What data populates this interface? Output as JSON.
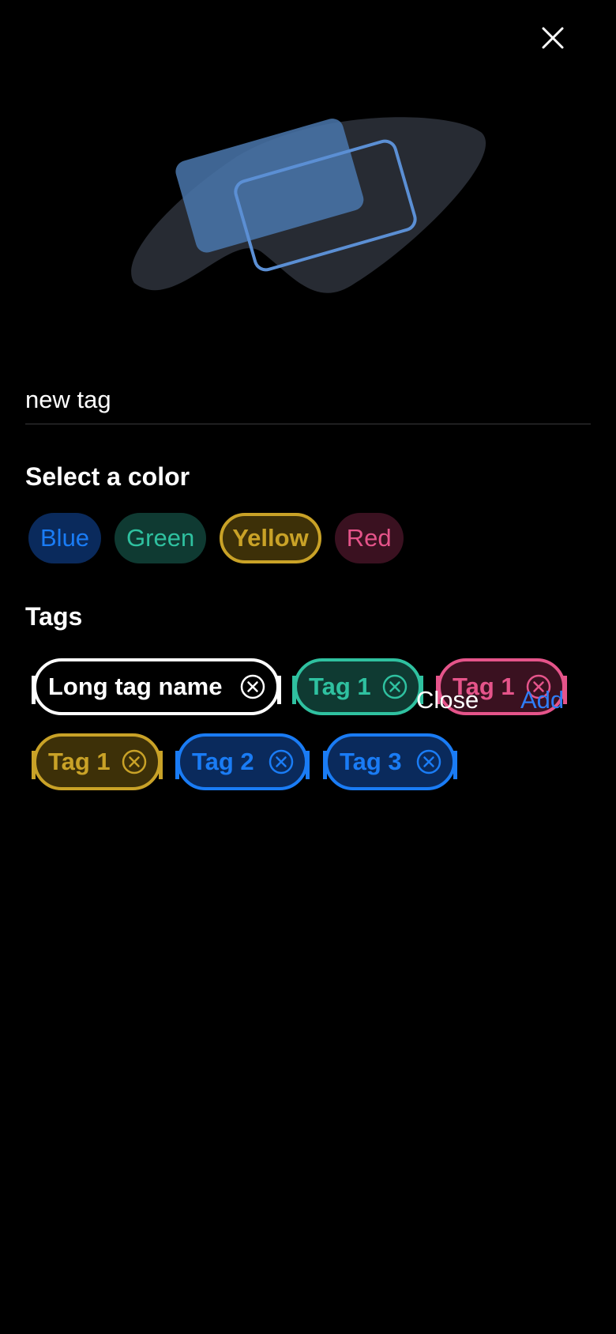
{
  "name_field": {
    "value": "new tag"
  },
  "color_section": {
    "title": "Select a color",
    "options": [
      {
        "label": "Blue",
        "text": "#1a7cf5",
        "bg": "#0a2a5c",
        "selected": false
      },
      {
        "label": "Green",
        "text": "#2fc1a0",
        "bg": "#0f3a32",
        "selected": false
      },
      {
        "label": "Yellow",
        "text": "#c9a227",
        "bg": "#3d3008",
        "selected": true
      },
      {
        "label": "Red",
        "text": "#e5548a",
        "bg": "#3a1120",
        "selected": false
      }
    ]
  },
  "tags_section": {
    "title": "Tags",
    "tags": [
      {
        "label": "Long tag name",
        "color": "#ffffff",
        "bg": "#000000"
      },
      {
        "label": "Tag 1",
        "color": "#2fc1a0",
        "bg": "#0f3a32"
      },
      {
        "label": "Tag 1",
        "color": "#e5548a",
        "bg": "#3a1120"
      },
      {
        "label": "Tag 1",
        "color": "#c9a227",
        "bg": "#3d3008"
      },
      {
        "label": "Tag 2",
        "color": "#1a7cf5",
        "bg": "#0a2a5c"
      },
      {
        "label": "Tag 3",
        "color": "#1a7cf5",
        "bg": "#0a2a5c"
      }
    ]
  },
  "actions": {
    "close_label": "Close",
    "add_label": "Add",
    "add_color": "#2f7df6"
  },
  "icons": {
    "dismiss": "close-icon",
    "remove_tag": "remove-circle-icon"
  }
}
